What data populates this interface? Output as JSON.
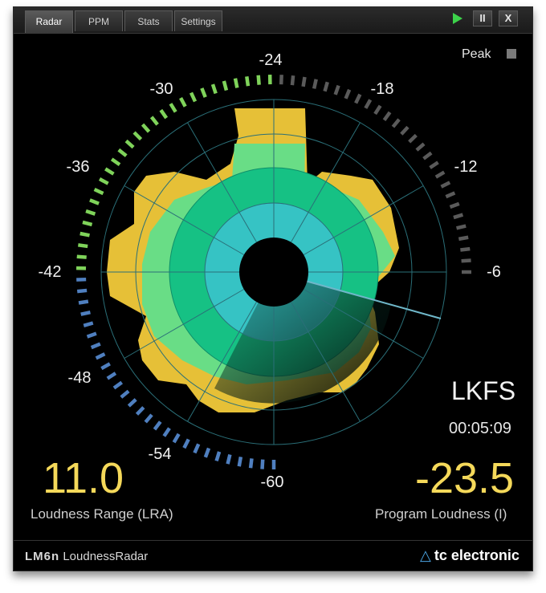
{
  "tabs": [
    {
      "label": "Radar",
      "active": true
    },
    {
      "label": "PPM",
      "active": false
    },
    {
      "label": "Stats",
      "active": false
    },
    {
      "label": "Settings",
      "active": false
    }
  ],
  "controls": {
    "play_icon": "play-icon",
    "pause_label": "II",
    "close_label": "X"
  },
  "peak": {
    "label": "Peak",
    "indicator_color": "#7a7a7a"
  },
  "scale": {
    "labels": [
      "-24",
      "-18",
      "-12",
      "-6",
      "-60",
      "-54",
      "-48",
      "-42",
      "-36",
      "-30"
    ],
    "min": -60,
    "max": -6,
    "active_upto": -24
  },
  "readouts": {
    "unit": "LKFS",
    "elapsed_time": "00:05:09",
    "lra_value": "11.0",
    "lra_label": "Loudness Range (LRA)",
    "program_value": "-23.5",
    "program_label": "Program Loudness (I)"
  },
  "footer": {
    "product_model": "LM6n",
    "product_name": "LoudnessRadar",
    "brand": "tc electronic"
  },
  "colors": {
    "accent_yellow": "#f5d95a",
    "ring_blue": "#4f7fbf",
    "ring_green": "#7fd35a",
    "ring_gray": "#5a5a5a"
  }
}
